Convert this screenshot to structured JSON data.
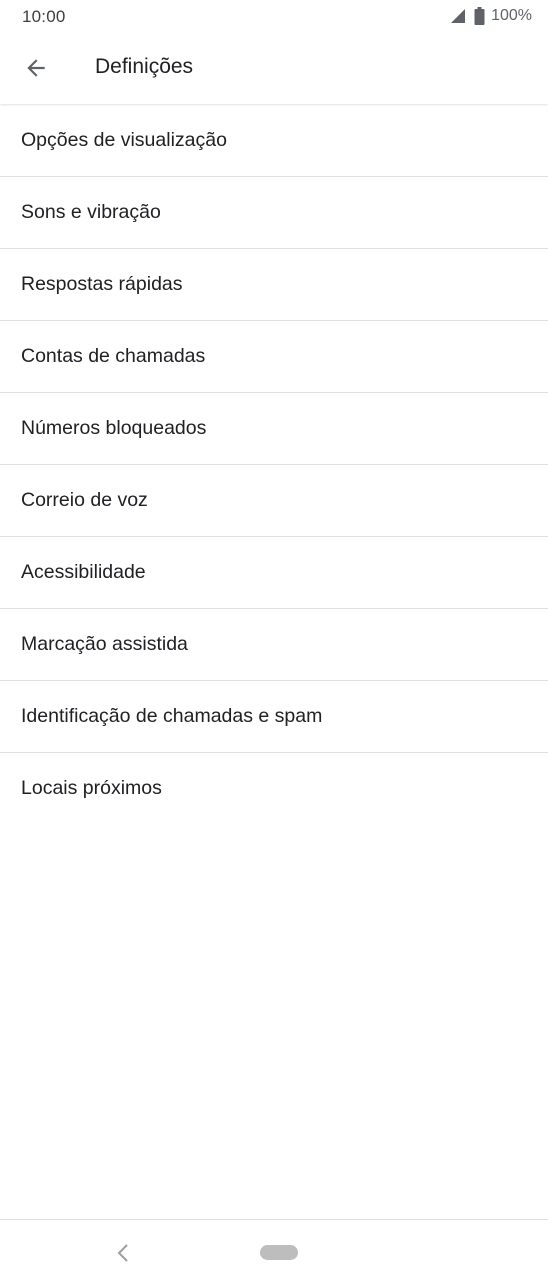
{
  "status_bar": {
    "time": "10:00",
    "battery": "100%",
    "signal_icon": "signal-icon",
    "battery_icon": "battery-icon"
  },
  "app_bar": {
    "title": "Definições",
    "back_icon": "arrow-back-icon"
  },
  "settings": {
    "items": [
      {
        "label": "Opções de visualização"
      },
      {
        "label": "Sons e vibração"
      },
      {
        "label": "Respostas rápidas"
      },
      {
        "label": "Contas de chamadas"
      },
      {
        "label": "Números bloqueados"
      },
      {
        "label": "Correio de voz"
      },
      {
        "label": "Acessibilidade"
      },
      {
        "label": "Marcação assistida"
      },
      {
        "label": "Identificação de chamadas e spam"
      },
      {
        "label": "Locais próximos"
      }
    ]
  },
  "nav_bar": {
    "back_icon": "chevron-left-icon",
    "home_icon": "home-pill-icon"
  },
  "colors": {
    "text_primary": "#202124",
    "divider": "#e0e0e0",
    "background": "#ffffff"
  }
}
